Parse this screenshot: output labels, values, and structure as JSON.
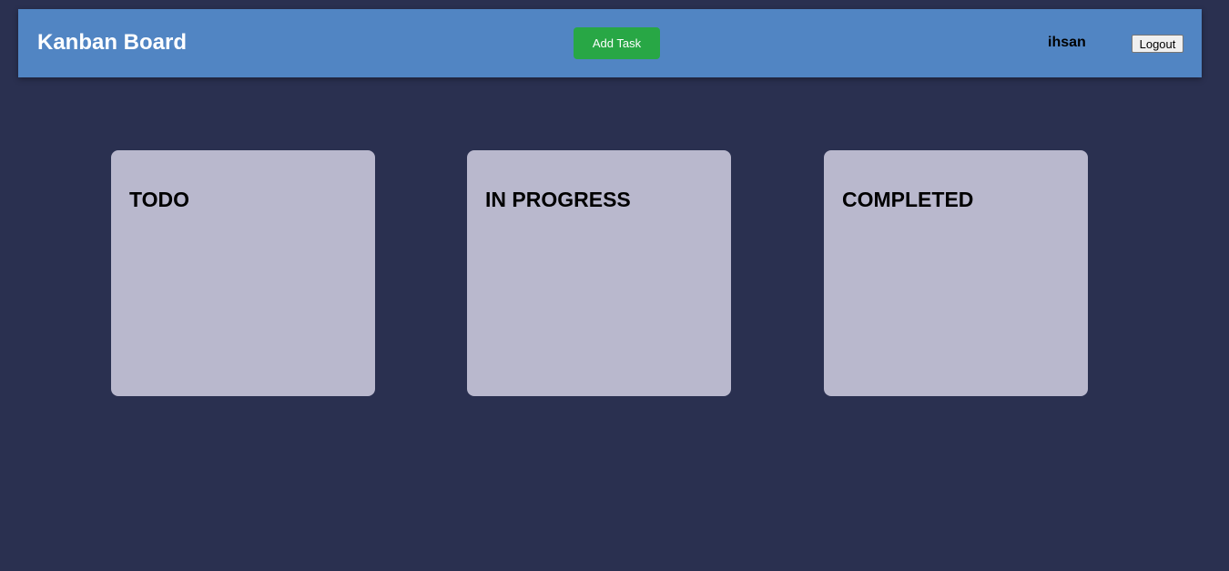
{
  "header": {
    "title": "Kanban Board",
    "add_task_label": "Add Task",
    "username": "ihsan",
    "logout_label": "Logout"
  },
  "columns": [
    {
      "title": "TODO"
    },
    {
      "title": "IN PROGRESS"
    },
    {
      "title": "COMPLETED"
    }
  ],
  "colors": {
    "background": "#2a3050",
    "header": "#5185c3",
    "add_task_button": "#28a745",
    "column": "#b9b8cd"
  }
}
